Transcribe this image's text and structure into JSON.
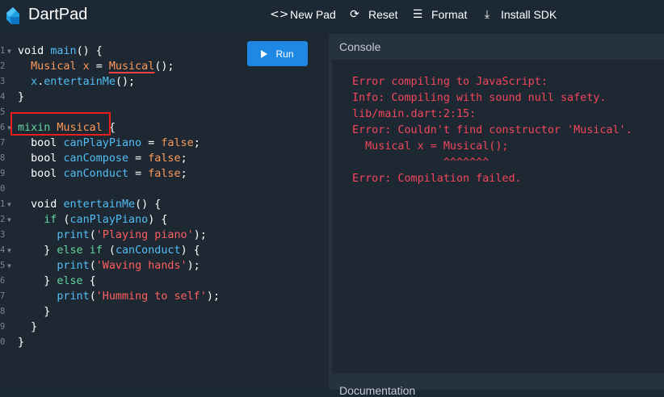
{
  "header": {
    "title": "DartPad",
    "new_pad": "New Pad",
    "reset": "Reset",
    "format": "Format",
    "install_sdk": "Install SDK"
  },
  "editor": {
    "run_label": "Run",
    "gutter": [
      "1",
      "2",
      "3",
      "4",
      "5",
      "6",
      "7",
      "8",
      "9",
      "0",
      "1",
      "2",
      "3",
      "4",
      "5",
      "6",
      "7",
      "8",
      "9",
      "0"
    ],
    "fold_lines": [
      1,
      6,
      11,
      12,
      14,
      15
    ]
  },
  "code": {
    "l1_kw": "void",
    "l1_fn": "main",
    "l1_rest": "() {",
    "l2_type": "Musical",
    "l2_var": "x",
    "l2_eq": " = ",
    "l2_ctor": "Musical",
    "l2_rest": "();",
    "l3_obj": "x",
    "l3_dot": ".",
    "l3_call": "entertainMe",
    "l3_rest": "();",
    "l4": "}",
    "l6_kw": "mixin",
    "l6_name": "Musical",
    "l6_brace": " {",
    "l7_kw": "bool",
    "l7_var": "canPlayPiano",
    "l7_eq": " = ",
    "l7_val": "false",
    "l7_semi": ";",
    "l8_kw": "bool",
    "l8_var": "canCompose",
    "l8_eq": " = ",
    "l8_val": "false",
    "l8_semi": ";",
    "l9_kw": "bool",
    "l9_var": "canConduct",
    "l9_eq": " = ",
    "l9_val": "false",
    "l9_semi": ";",
    "l11_kw": "void",
    "l11_fn": "entertainMe",
    "l11_rest": "() {",
    "l12_kw": "if",
    "l12_open": " (",
    "l12_var": "canPlayPiano",
    "l12_rest": ") {",
    "l13_fn": "print",
    "l13_open": "(",
    "l13_str": "'Playing piano'",
    "l13_rest": ");",
    "l14_pre": "} ",
    "l14_kw": "else if",
    "l14_open": " (",
    "l14_var": "canConduct",
    "l14_rest": ") {",
    "l15_fn": "print",
    "l15_open": "(",
    "l15_str": "'Waving hands'",
    "l15_rest": ");",
    "l16_pre": "} ",
    "l16_kw": "else",
    "l16_rest": " {",
    "l17_fn": "print",
    "l17_open": "(",
    "l17_str": "'Humming to self'",
    "l17_rest": ");",
    "l18": "}",
    "l19": "}",
    "l20": "}"
  },
  "console": {
    "title": "Console",
    "output": "Error compiling to JavaScript:\nInfo: Compiling with sound null safety.\nlib/main.dart:2:15:\nError: Couldn't find constructor 'Musical'.\n  Musical x = Musical();\n              ^^^^^^^\nError: Compilation failed.",
    "error_color": "#f3465b"
  },
  "docs": {
    "label": "Documentation"
  },
  "colors": {
    "background": "#1c2834",
    "run_button": "#1e88e5",
    "highlight_box": "#e81e1e"
  }
}
